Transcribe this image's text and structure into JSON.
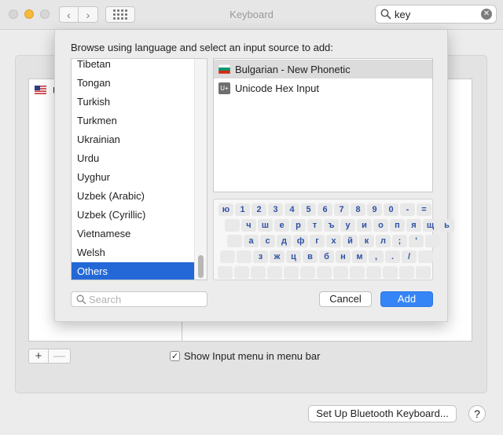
{
  "window": {
    "title": "Keyboard",
    "search": {
      "value": "key"
    }
  },
  "background": {
    "list_item_label": "U",
    "show_input_menu_label": "Show Input menu in menu bar",
    "show_input_menu_checked": true,
    "bluetooth_button": "Set Up Bluetooth Keyboard...",
    "help_button": "?",
    "plus_button": "+",
    "minus_button": "—"
  },
  "sheet": {
    "prompt": "Browse using language and select an input source to add:",
    "languages": [
      {
        "label": "Tibetan",
        "selected": false
      },
      {
        "label": "Tongan",
        "selected": false
      },
      {
        "label": "Turkish",
        "selected": false
      },
      {
        "label": "Turkmen",
        "selected": false
      },
      {
        "label": "Ukrainian",
        "selected": false
      },
      {
        "label": "Urdu",
        "selected": false
      },
      {
        "label": "Uyghur",
        "selected": false
      },
      {
        "label": "Uzbek (Arabic)",
        "selected": false
      },
      {
        "label": "Uzbek (Cyrillic)",
        "selected": false
      },
      {
        "label": "Vietnamese",
        "selected": false
      },
      {
        "label": "Welsh",
        "selected": false
      },
      {
        "label": "Others",
        "selected": true
      }
    ],
    "sources": [
      {
        "label": "Bulgarian - New Phonetic",
        "icon": "bulgaria-flag-icon",
        "selected": true
      },
      {
        "label": "Unicode Hex Input",
        "icon": "unicode-hex-icon",
        "icon_text": "U+",
        "selected": false
      }
    ],
    "keyboard_rows": [
      [
        "ю",
        "1",
        "2",
        "3",
        "4",
        "5",
        "6",
        "7",
        "8",
        "9",
        "0",
        "-",
        "="
      ],
      [
        "",
        "ч",
        "ш",
        "е",
        "р",
        "т",
        "ъ",
        "у",
        "и",
        "о",
        "п",
        "я",
        "щ",
        "ь"
      ],
      [
        "",
        "а",
        "с",
        "д",
        "ф",
        "г",
        "х",
        "й",
        "к",
        "л",
        ";",
        "'",
        ""
      ],
      [
        "",
        "",
        "з",
        "ж",
        "ц",
        "в",
        "б",
        "н",
        "м",
        ",",
        ".",
        "/",
        ""
      ],
      [
        "",
        "",
        "",
        "",
        "",
        "",
        "",
        "",
        "",
        "",
        "",
        "",
        ""
      ]
    ],
    "search_placeholder": "Search",
    "cancel_label": "Cancel",
    "add_label": "Add"
  },
  "colors": {
    "accent": "#3585f6",
    "selection": "#2468d8",
    "key_text": "#2f52a6"
  }
}
